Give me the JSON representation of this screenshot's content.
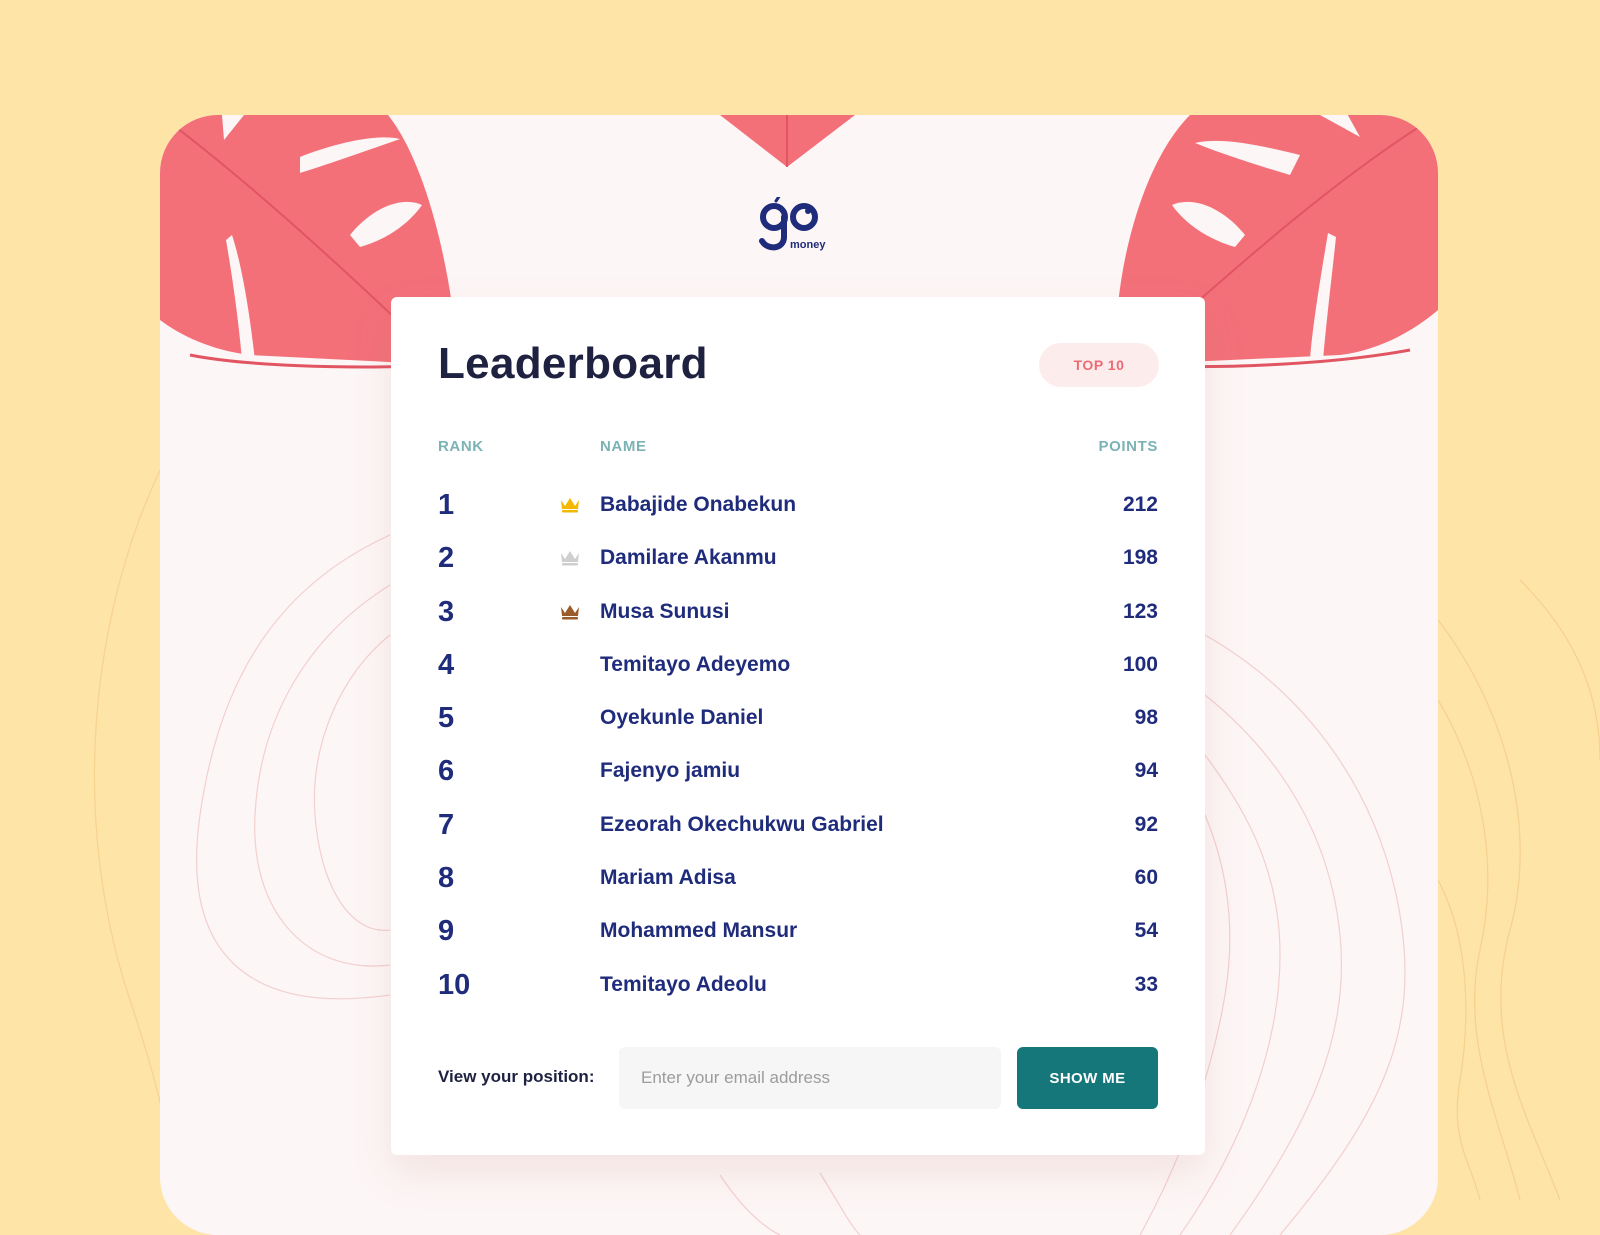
{
  "brand": {
    "logo_text": "money",
    "logo_icon": "go-money-logo-icon"
  },
  "leaderboard": {
    "title": "Leaderboard",
    "badge": "TOP 10",
    "columns": {
      "rank": "RANK",
      "name": "NAME",
      "points": "POINTS"
    },
    "rows": [
      {
        "rank": "1",
        "name": "Babajide Onabekun",
        "points": "212",
        "crown": "gold"
      },
      {
        "rank": "2",
        "name": "Damilare Akanmu",
        "points": "198",
        "crown": "silver"
      },
      {
        "rank": "3",
        "name": "Musa Sunusi",
        "points": "123",
        "crown": "bronze"
      },
      {
        "rank": "4",
        "name": "Temitayo Adeyemo",
        "points": "100"
      },
      {
        "rank": "5",
        "name": "Oyekunle Daniel",
        "points": "98"
      },
      {
        "rank": "6",
        "name": "Fajenyo jamiu",
        "points": "94"
      },
      {
        "rank": "7",
        "name": "Ezeorah Okechukwu Gabriel",
        "points": "92"
      },
      {
        "rank": "8",
        "name": "Mariam Adisa",
        "points": "60"
      },
      {
        "rank": "9",
        "name": "Mohammed Mansur",
        "points": "54"
      },
      {
        "rank": "10",
        "name": "Temitayo Adeolu",
        "points": "33"
      }
    ]
  },
  "position_form": {
    "label": "View your position:",
    "email_placeholder": "Enter your email address",
    "email_value": "",
    "button_label": "SHOW ME"
  },
  "colors": {
    "page_bg": "#FFE4A8",
    "frame_bg": "#FDF6F6",
    "leaf": "#F37079",
    "navy": "#1F2B7B",
    "teal_button": "#16777A",
    "header_teal": "#7BB3B4",
    "badge_text": "#EC6C74",
    "crown_gold": "#F5B800",
    "crown_silver": "#CFCFCF",
    "crown_bronze": "#9B5B2A"
  }
}
